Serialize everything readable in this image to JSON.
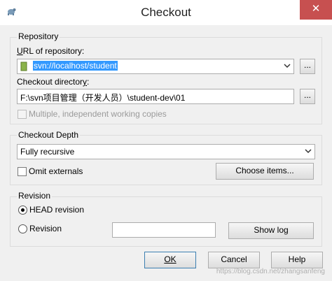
{
  "window": {
    "title": "Checkout",
    "close_glyph": "✕"
  },
  "repository": {
    "group_label": "Repository",
    "url_label": "URL of repository:",
    "url_value": "svn://localhost/student",
    "browse_label": "...",
    "dir_label": "Checkout directory:",
    "dir_value": "F:\\svn项目管理（开发人员）\\student-dev\\01",
    "dir_browse_label": "...",
    "multiple_label": "Multiple, independent working copies"
  },
  "depth": {
    "group_label": "Checkout Depth",
    "selected": "Fully recursive",
    "omit_label": "Omit externals",
    "choose_label": "Choose items..."
  },
  "revision": {
    "group_label": "Revision",
    "head_label": "HEAD revision",
    "rev_label": "Revision",
    "rev_value": "",
    "show_log_label": "Show log"
  },
  "buttons": {
    "ok": "OK",
    "cancel": "Cancel",
    "help": "Help"
  },
  "watermark": "https://blog.csdn.net/zhangsanfeng",
  "colors": {
    "selection": "#3399ff",
    "close_button": "#c75050"
  }
}
